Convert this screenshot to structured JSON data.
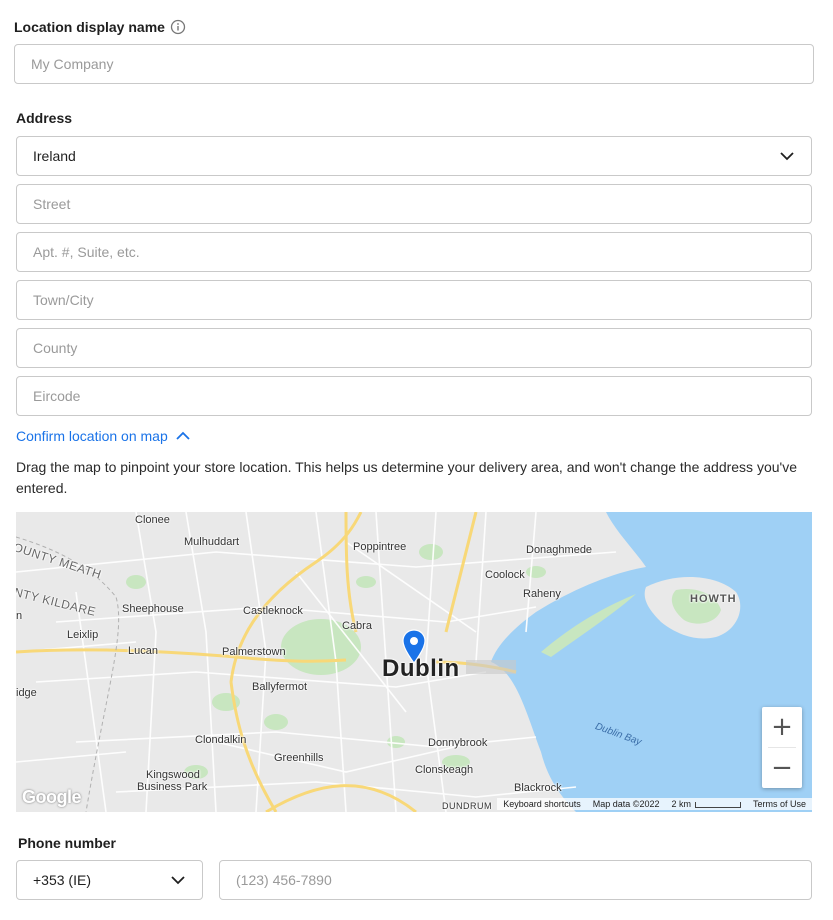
{
  "location": {
    "label": "Location display name",
    "placeholder": "My Company"
  },
  "address": {
    "label": "Address",
    "country_value": "Ireland",
    "street_placeholder": "Street",
    "apt_placeholder": "Apt. #, Suite, etc.",
    "city_placeholder": "Town/City",
    "county_placeholder": "County",
    "eircode_placeholder": "Eircode"
  },
  "confirm": {
    "link_label": "Confirm location on map",
    "help_text": "Drag the map to pinpoint your store location. This helps us determine your delivery area, and won't change the address you've entered."
  },
  "map": {
    "places": {
      "clonee": "Clonee",
      "mulhuddart": "Mulhuddart",
      "poppintree": "Poppintree",
      "donaghmede": "Donaghmede",
      "coolock": "Coolock",
      "raheny": "Raheny",
      "howth": "HOWTH",
      "county_meath": "OUNTY MEATH",
      "county_kildare": "NTY KILDARE",
      "sheephouse": "Sheephouse",
      "castleknock": "Castleknock",
      "cabra": "Cabra",
      "leixlip": "Leixlip",
      "lucan": "Lucan",
      "palmerstown": "Palmerstown",
      "dublin": "Dublin",
      "ballyfermot": "Ballyfermot",
      "bridge": "idge",
      "m": "n",
      "dublin_bay": "Dublin Bay",
      "clondalkin": "Clondalkin",
      "donnybrook": "Donnybrook",
      "greenhills": "Greenhills",
      "clonskeagh": "Clonskeagh",
      "kingswood": "Kingswood",
      "business_park": "Business Park",
      "blackrock": "Blackrock",
      "dundrum": "DUNDRUM"
    },
    "google_logo": "Google",
    "attrib_shortcuts": "Keyboard shortcuts",
    "attrib_data": "Map data ©2022",
    "attrib_scale": "2 km",
    "attrib_terms": "Terms of Use",
    "zoom_in": "+",
    "zoom_out": "−",
    "colors": {
      "water": "#9fd0f5",
      "land": "#e9e9e9",
      "park": "#c8e6c0",
      "road": "#ffffff",
      "highway": "#f8d878",
      "pin": "#1a73e8"
    }
  },
  "phone": {
    "label": "Phone number",
    "country_code": "+353 (IE)",
    "placeholder": "(123) 456-7890"
  }
}
